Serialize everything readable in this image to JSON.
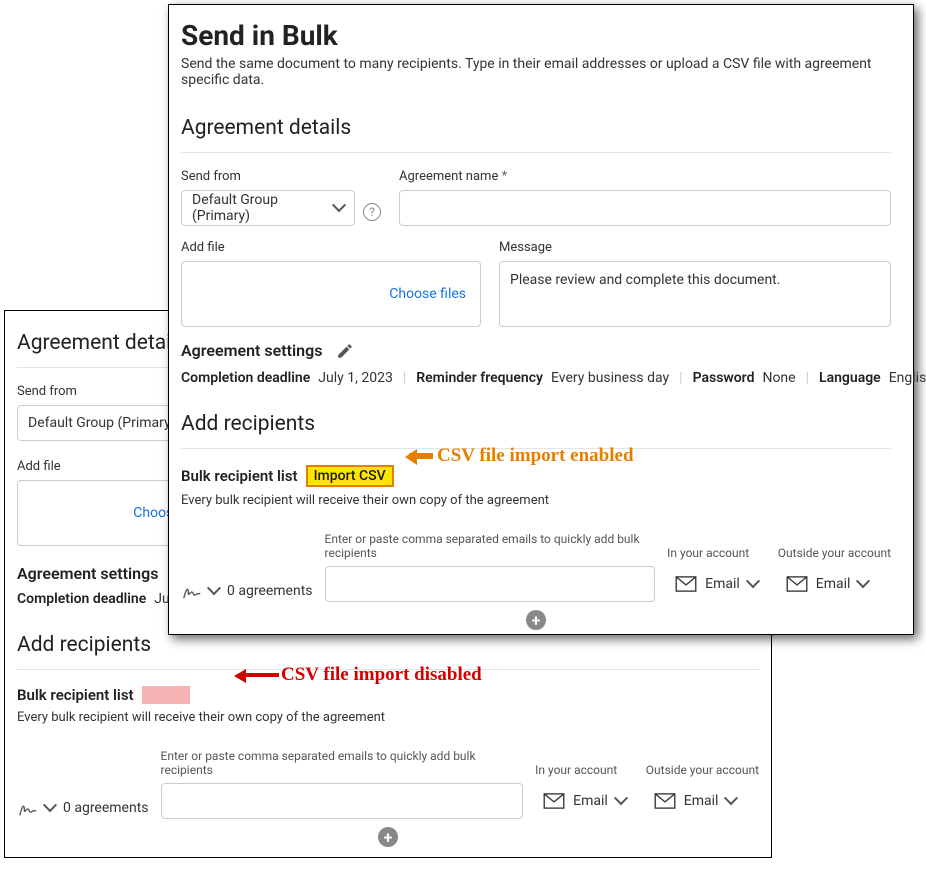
{
  "page": {
    "title": "Send in Bulk",
    "subtitle": "Send the same document to many recipients. Type in their email addresses or upload a CSV file with agreement specific data."
  },
  "sections": {
    "agreement_details": "Agreement details",
    "add_recipients": "Add recipients",
    "agreement_settings": "Agreement settings"
  },
  "labels": {
    "send_from": "Send from",
    "agreement_name": "Agreement name",
    "required": "*",
    "add_file": "Add file",
    "choose_files": "Choose files",
    "message": "Message",
    "bulk_recipient_list": "Bulk recipient list",
    "import_csv": "Import CSV",
    "bulk_desc": "Every bulk recipient will receive their own copy of the agreement",
    "email_hint": "Enter or paste comma separated emails to quickly add bulk recipients",
    "in_your_account": "In your account",
    "outside_account": "Outside your account",
    "email": "Email",
    "agreements_count": "0 agreements"
  },
  "values": {
    "send_from_selected": "Default Group (Primary)",
    "message_default": "Please review and complete this document."
  },
  "settings": {
    "completion_deadline_key": "Completion deadline",
    "completion_deadline_val": "July 1, 2023",
    "reminder_key": "Reminder frequency",
    "reminder_val": "Every business day",
    "password_key": "Password",
    "password_val": "None",
    "language_key": "Language",
    "language_val": "English/US"
  },
  "annotations": {
    "enabled": "CSV file import enabled",
    "disabled": "CSV file import disabled"
  }
}
